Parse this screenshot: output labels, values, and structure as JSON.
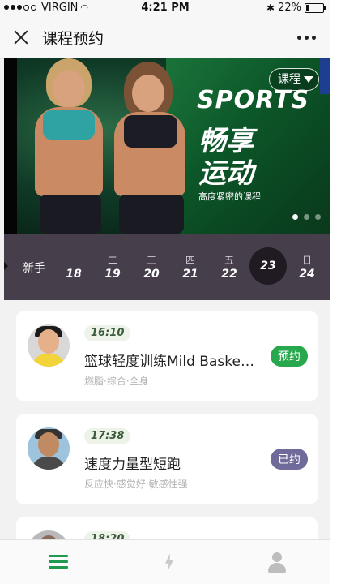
{
  "status_bar": {
    "carrier": "VIRGIN",
    "time": "4:21 PM",
    "battery": "22%",
    "battery_level": 0.22
  },
  "header": {
    "title": "课程预约"
  },
  "banner": {
    "course_button_label": "课程",
    "sports_text": "SPORTS",
    "headline_line1": "畅享",
    "headline_line2": "运动",
    "subline": "高度紧密的课程",
    "pager_count": 3,
    "pager_active": 0
  },
  "date_strip": {
    "newbie_label": "新手",
    "days": [
      {
        "weekday": "一",
        "date": "18"
      },
      {
        "weekday": "二",
        "date": "19"
      },
      {
        "weekday": "三",
        "date": "20"
      },
      {
        "weekday": "四",
        "date": "21"
      },
      {
        "weekday": "五",
        "date": "22"
      },
      {
        "weekday": "",
        "date": "23",
        "selected": true
      },
      {
        "weekday": "日",
        "date": "24"
      }
    ]
  },
  "courses": [
    {
      "time": "16:10",
      "name": "篮球轻度训练Mild Basket...",
      "tags": "燃脂·综合·全身",
      "button": "预约",
      "status": "available",
      "button_color": "#27a84d"
    },
    {
      "time": "17:38",
      "name": "速度力量型短跑",
      "tags": "反应快·感觉好·敏感性强",
      "button": "已约",
      "status": "booked",
      "button_color": "#6e6a9a"
    },
    {
      "time": "18:20",
      "name": "",
      "tags": "",
      "button": "",
      "status": "partial"
    }
  ],
  "tab_bar": {
    "tabs": [
      {
        "icon": "menu-icon",
        "active": true
      },
      {
        "icon": "bolt-icon",
        "active": false
      },
      {
        "icon": "user-icon",
        "active": false
      }
    ]
  },
  "colors": {
    "accent_green": "#27a84d",
    "booked_purple": "#6e6a9a",
    "date_strip_bg": "#463e4a"
  }
}
